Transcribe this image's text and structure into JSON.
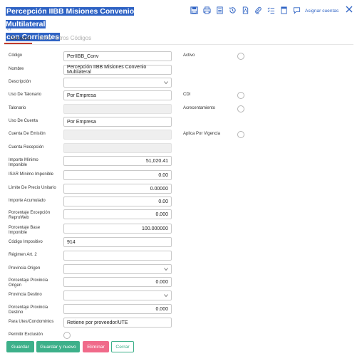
{
  "header": {
    "title_line1": "Percepción IIBB Misiones Convenio Multilateral",
    "title_line2": "con Corrientes",
    "assign_link": "Asignar cuentas"
  },
  "toolbar_icons": [
    "save-icon",
    "print-icon",
    "calculator-icon",
    "history-icon",
    "pdf-icon",
    "attachment-icon",
    "checklist-icon",
    "notes-icon",
    "chat-icon"
  ],
  "nav": {
    "arrows": "‹›"
  },
  "tabs": [
    {
      "label": "General",
      "active": true
    },
    {
      "label": "Items",
      "active": false
    },
    {
      "label": "Otros Códigos",
      "active": false
    }
  ],
  "form": {
    "codigo": {
      "label": "Código",
      "value": "PerIIBB_Conv"
    },
    "nombre": {
      "label": "Nombre",
      "value": "Percepción IIBB Misiones Convenio Multilateral"
    },
    "descripcion": {
      "label": "Descripción",
      "value": ""
    },
    "uso_talonario": {
      "label": "Uso De Talonario",
      "value": "Por Empresa"
    },
    "talonario": {
      "label": "Talonario",
      "value": ""
    },
    "uso_cuenta": {
      "label": "Uso De Cuenta",
      "value": "Por Empresa"
    },
    "cuenta_emision": {
      "label": "Cuenta De Emisión",
      "value": ""
    },
    "cuenta_recepcion": {
      "label": "Cuenta Recepción",
      "value": ""
    },
    "importe_minimo": {
      "label1": "Importe Mínimo",
      "label2": "Imponible",
      "value": "51,020.41"
    },
    "isar_minimo": {
      "label": "ISAR Mínimo Imponible",
      "value": "0.00"
    },
    "limite_precio": {
      "label": "Límite De Precio Unitario",
      "value": "0.00000"
    },
    "importe_acumulado": {
      "label": "Importe Acumulado",
      "value": "0.00"
    },
    "porc_excepcion": {
      "label1": "Porcentaje Excepción",
      "label2": "ReproWeb",
      "value": "0.000"
    },
    "porc_base": {
      "label1": "Porcentaje Base",
      "label2": "Imponible",
      "value": "100.000000"
    },
    "codigo_impositivo": {
      "label": "Código Impositivo",
      "value": "914"
    },
    "regimen": {
      "label": "Régimen Art. 2",
      "value": ""
    },
    "provincia_origen": {
      "label": "Provincia Origen",
      "value": ""
    },
    "porc_prov_origen": {
      "label1": "Porcentaje Provincia",
      "label2": "Origen",
      "value": "0.000"
    },
    "provincia_destino": {
      "label": "Provincia Destino",
      "value": ""
    },
    "porc_prov_destino": {
      "label1": "Porcentaje Provincia",
      "label2": "Destino",
      "value": "0.000"
    },
    "para_utes": {
      "label": "Para Utes/Condominios",
      "value": "Retiene por proveedor/UTE"
    },
    "permitir_exclusion": {
      "label": "Permitir Exclusión"
    },
    "activo": {
      "label": "Activo"
    },
    "cdi": {
      "label": "CDI"
    },
    "acrecentamiento": {
      "label": "Acrecentamiento"
    },
    "aplica_vigencia": {
      "label": "Aplica Por Vigencia"
    }
  },
  "buttons": {
    "save": "Guardar",
    "save_new": "Guardar y nuevo",
    "delete": "Eliminar",
    "close": "Cerrar"
  },
  "colors": {
    "accent": "#2f63c4",
    "save": "#3db08a",
    "delete": "#f06a8a",
    "tab_underline": "#c0392b"
  }
}
